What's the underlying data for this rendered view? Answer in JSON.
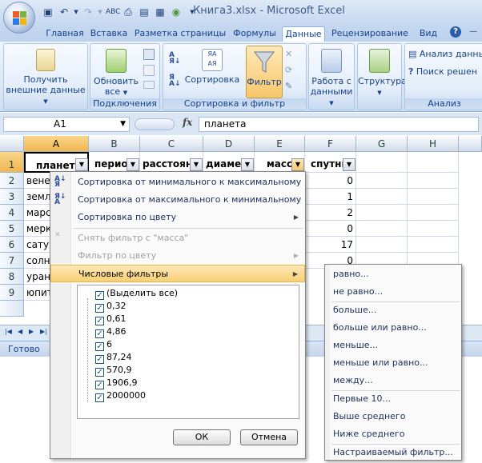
{
  "window": {
    "title": "Книга3.xlsx - Microsoft Excel",
    "qat_icons": [
      "save-icon",
      "undo-icon",
      "redo-icon",
      "spellcheck-icon",
      "print-preview-icon",
      "quick-print-icon",
      "chart-icon",
      "dropdown-arrow-icon"
    ]
  },
  "ribbon_tabs": [
    "Главная",
    "Вставка",
    "Разметка страницы",
    "Формулы",
    "Данные",
    "Рецензирование",
    "Вид"
  ],
  "active_tab": "Данные",
  "ribbon": {
    "get_external_line1": "Получить",
    "get_external_line2": "внешние данные",
    "refresh_line1": "Обновить",
    "refresh_line2": "все",
    "connections_label": "Подключения",
    "sort_label": "Сортировка",
    "filter_label": "Фильтр",
    "sort_filter_label": "Сортировка и фильтр",
    "data_tools_line1": "Работа с",
    "data_tools_line2": "данными",
    "outline_label": "Структура",
    "analysis_data": "Анализ данны",
    "solver": "Поиск решен",
    "analysis_label": "Анализ"
  },
  "formula_bar": {
    "name_box": "A1",
    "fx": "fx",
    "value": "планета"
  },
  "columns": [
    "A",
    "B",
    "C",
    "D",
    "E",
    "F",
    "G",
    "H"
  ],
  "rows": [
    "1",
    "2",
    "3",
    "4",
    "5",
    "6",
    "7",
    "8",
    "9"
  ],
  "header_row": [
    "планета",
    "перио",
    "расстоян",
    "диаме",
    "масса",
    "спутни"
  ],
  "col_a_values": [
    "вене",
    "земл",
    "марс",
    "мерк",
    "сатур",
    "солн",
    "уран",
    "юпит"
  ],
  "col_f_values": [
    "0",
    "1",
    "2",
    "0",
    "17",
    "0"
  ],
  "status": "Готово",
  "filter_menu": {
    "sort_asc": "Сортировка от минимального к максимальному",
    "sort_desc": "Сортировка от максимального к минимальному",
    "sort_color": "Сортировка по цвету",
    "clear_filter": "Снять фильтр с \"масса\"",
    "filter_color": "Фильтр по цвету",
    "number_filters": "Числовые фильтры",
    "values": [
      "(Выделить все)",
      "0,32",
      "0,61",
      "4,86",
      "6",
      "87,24",
      "570,9",
      "1906,9",
      "2000000"
    ],
    "ok": "ОК",
    "cancel": "Отмена"
  },
  "number_filters_submenu": [
    "равно...",
    "не равно...",
    "больше...",
    "больше или равно...",
    "меньше...",
    "меньше или равно...",
    "между...",
    "Первые 10...",
    "Выше среднего",
    "Ниже среднего",
    "Настраиваемый фильтр..."
  ]
}
